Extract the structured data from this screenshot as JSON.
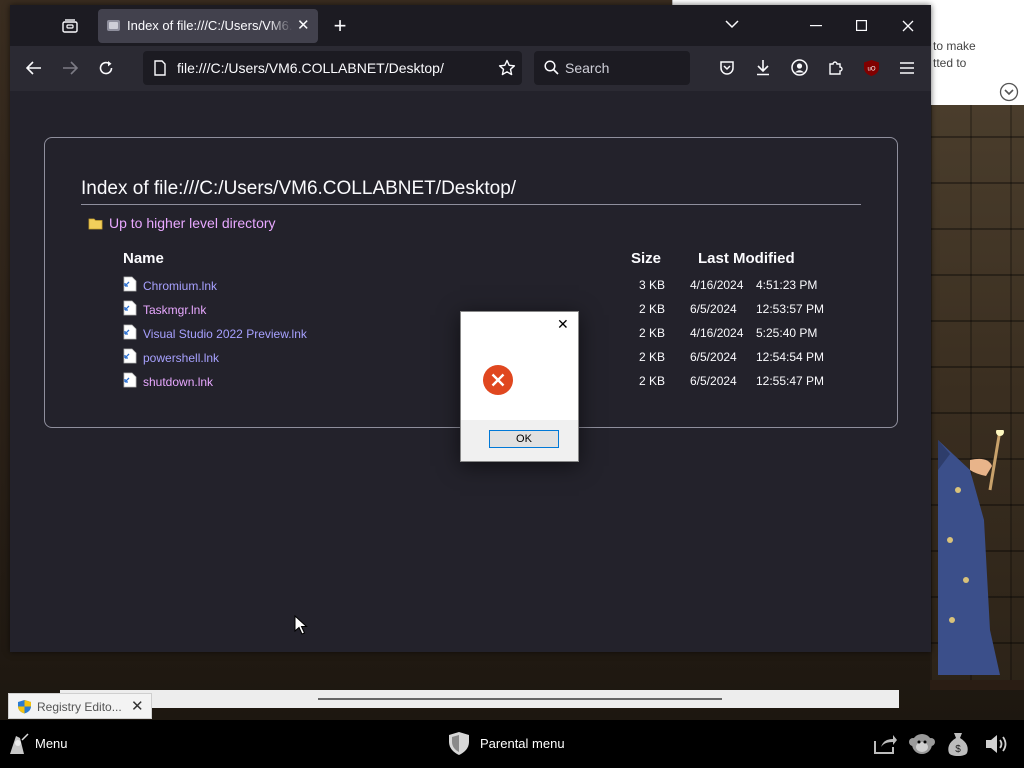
{
  "browser": {
    "tab": {
      "title": "Index of file:///C:/Users/VM6.COLLABNET/Desktop/"
    },
    "url": "file:///C:/Users/VM6.COLLABNET/Desktop/",
    "search_placeholder": "Search"
  },
  "listing": {
    "title": "Index of file:///C:/Users/VM6.COLLABNET/Desktop/",
    "up_link": "Up to higher level directory",
    "headers": {
      "name": "Name",
      "size": "Size",
      "last_modified": "Last Modified"
    },
    "files": [
      {
        "name": "Chromium.lnk",
        "size": "3 KB",
        "date": "4/16/2024",
        "time": "4:51:23 PM",
        "visited": false
      },
      {
        "name": "Taskmgr.lnk",
        "size": "2 KB",
        "date": "6/5/2024",
        "time": "12:53:57 PM",
        "visited": true
      },
      {
        "name": "Visual Studio 2022 Preview.lnk",
        "size": "2 KB",
        "date": "4/16/2024",
        "time": "5:25:40 PM",
        "visited": false
      },
      {
        "name": "powershell.lnk",
        "size": "2 KB",
        "date": "6/5/2024",
        "time": "12:54:54 PM",
        "visited": false
      },
      {
        "name": "shutdown.lnk",
        "size": "2 KB",
        "date": "6/5/2024",
        "time": "12:55:47 PM",
        "visited": true
      }
    ]
  },
  "dialog": {
    "ok_label": "OK",
    "close_glyph": "✕"
  },
  "background_window": {
    "text": "to make\ntted to"
  },
  "taskbar": {
    "menu_label": "Menu",
    "parental_label": "Parental menu",
    "registry_task_label": "Registry Edito..."
  },
  "colors": {
    "link": "#a7a1ff",
    "visited_link": "#e8a8ff",
    "error_icon": "#e0471f",
    "browser_bg": "#23222b"
  }
}
